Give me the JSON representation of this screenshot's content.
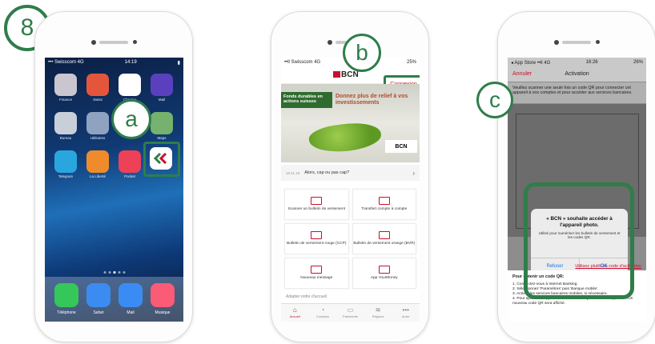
{
  "step_number": "8",
  "callouts": {
    "a": "a",
    "b": "b",
    "c": "c"
  },
  "colors": {
    "highlight": "#2f7d4a",
    "brand_red": "#c8102e",
    "link_blue": "#1a73e8"
  },
  "phone1": {
    "status": {
      "carrier": "••• Swisscom 4G",
      "time": "14:19",
      "battery": "▮"
    },
    "apps_row1": [
      {
        "label": "Finance",
        "color": "#c9c6cf",
        "icon": "finance-app-icon"
      },
      {
        "label": "Swiss",
        "color": "#e4563b",
        "icon": "swiss-app-icon"
      },
      {
        "label": "Chrome",
        "color": "#ffffff",
        "icon": "chrome-app-icon"
      },
      {
        "label": "Mail",
        "color": "#5a3fbf",
        "icon": "mail-app-icon"
      }
    ],
    "apps_row2": [
      {
        "label": "Bureau",
        "color": "#c8cfd9",
        "icon": "bureau-app-icon"
      },
      {
        "label": "Utilitaires",
        "color": "#8fa3c1",
        "icon": "utilities-app-icon"
      },
      {
        "label": "",
        "color": "#ffffff",
        "icon": "blank-app-icon"
      },
      {
        "label": "Maps",
        "color": "#74b26d",
        "icon": "maps-app-icon"
      }
    ],
    "apps_row3": [
      {
        "label": "Telegram",
        "color": "#2aa6df",
        "icon": "telegram-app-icon"
      },
      {
        "label": "La Liberté",
        "color": "#f08b2b",
        "icon": "news-app-icon"
      },
      {
        "label": "Pocket",
        "color": "#ee4056",
        "icon": "pocket-app-icon"
      }
    ],
    "dock": [
      {
        "label": "Téléphone",
        "color": "#35c759",
        "icon": "phone-app-icon"
      },
      {
        "label": "Safari",
        "color": "#3b8cf0",
        "icon": "safari-app-icon"
      },
      {
        "label": "Mail",
        "color": "#3a8cf4",
        "icon": "mail-dock-icon"
      },
      {
        "label": "Musique",
        "color": "#fb5b77",
        "icon": "music-app-icon"
      }
    ]
  },
  "phone2": {
    "status": {
      "carrier": "••ll Swisscom 4G",
      "time": "",
      "battery": "25%"
    },
    "logo": "BCN",
    "connexion": "Connexion",
    "banner": {
      "tag": "Fonds durables en actions suisses",
      "title": "Donnez plus de relief à vos investissements",
      "brand": "BCN"
    },
    "news": {
      "date": "18.11.19",
      "text": "Alors, cap ou pas cap?"
    },
    "tiles": [
      {
        "label": "Scanner un bulletin de versement",
        "icon": "scan-icon"
      },
      {
        "label": "Transfert compte à compte",
        "icon": "transfer-icon"
      },
      {
        "label": "Bulletin de versement rouge (CCP)",
        "icon": "red-slip-icon"
      },
      {
        "label": "Bulletin de versement orange (BVR)",
        "icon": "orange-slip-icon"
      },
      {
        "label": "Nouveau message",
        "icon": "message-icon"
      },
      {
        "label": "App YourMoney",
        "icon": "yourmoney-icon"
      }
    ],
    "more_label": "Adapter ordre d'accueil",
    "tabs": [
      {
        "label": "Accueil",
        "glyph": "⌂",
        "icon": "home-tab-icon"
      },
      {
        "label": "Comptes",
        "glyph": "◔",
        "icon": "accounts-tab-icon"
      },
      {
        "label": "Paiements",
        "glyph": "▭",
        "icon": "payments-tab-icon"
      },
      {
        "label": "Régions",
        "glyph": "≋",
        "icon": "regions-tab-icon"
      },
      {
        "label": "Autre",
        "glyph": "•••",
        "icon": "more-tab-icon"
      }
    ]
  },
  "phone3": {
    "status": {
      "carrier": "◂ App Store ••ll 4G",
      "time": "16:26",
      "battery": "26%"
    },
    "nav": {
      "cancel": "Annuler",
      "title": "Activation"
    },
    "intro": "Veuillez scanner une seule fois un code QR pour connecter cet appareil à vos comptes et pour accéder aux services bancaires.",
    "alert": {
      "title": "« BCN » souhaite accéder à l'appareil photo.",
      "message": "Utilisé pour numériser les bulletin de versement et les codes QR.",
      "refuse": "Refuser",
      "ok": "OK"
    },
    "alt_link": "Utilisez plutôt un code d'activation",
    "help": {
      "title": "Pour obtenir un code QR:",
      "steps": [
        "1. Connectez-vous à Internet Banking.",
        "2. Sélectionnez 'Paramètres' puis 'Banque mobile'.",
        "3. Activez les services bancaires mobiles, si nécessaire.",
        "4. Pour ajouter un appareil, sélectionnez «Ajouter nouvel appareil». Un nouveau code QR sera affiché."
      ]
    }
  }
}
